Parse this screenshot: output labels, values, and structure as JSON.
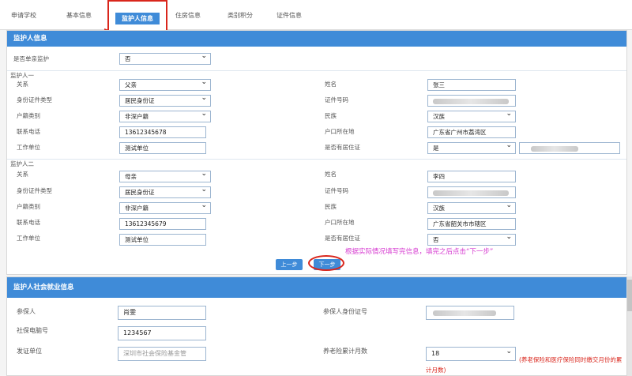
{
  "tabs": [
    {
      "label": "申请学校"
    },
    {
      "label": "基本信息"
    },
    {
      "label": "监护人信息"
    },
    {
      "label": "住房信息"
    },
    {
      "label": "类别积分"
    },
    {
      "label": "证件信息"
    }
  ],
  "panel1": {
    "title": "监护人信息",
    "single_parent_label": "是否单亲监护",
    "single_parent_value": "否",
    "guardian1": {
      "title": "监护人一",
      "relation_label": "关系",
      "relation_value": "父亲",
      "id_type_label": "身份证件类型",
      "id_type_value": "居民身份证",
      "hukou_label": "户籍类别",
      "hukou_value": "非深户籍",
      "phone_label": "联系电话",
      "phone_value": "13612345678",
      "work_label": "工作单位",
      "work_value": "测试单位",
      "name_label": "姓名",
      "name_value": "张三",
      "id_no_label": "证件号码",
      "ethnic_label": "民族",
      "ethnic_value": "汉族",
      "hukou_place_label": "户口所在地",
      "hukou_place_value": "广东省广州市荔湾区",
      "residence_label": "是否有居住证",
      "residence_value": "是"
    },
    "guardian2": {
      "title": "监护人二",
      "relation_label": "关系",
      "relation_value": "母亲",
      "id_type_label": "身份证件类型",
      "id_type_value": "居民身份证",
      "hukou_label": "户籍类别",
      "hukou_value": "非深户籍",
      "phone_label": "联系电话",
      "phone_value": "13612345679",
      "work_label": "工作单位",
      "work_value": "测试单位",
      "name_label": "姓名",
      "name_value": "李四",
      "id_no_label": "证件号码",
      "ethnic_label": "民族",
      "ethnic_value": "汉族",
      "hukou_place_label": "户口所在地",
      "hukou_place_value": "广东省韶关市市辖区",
      "residence_label": "是否有居住证",
      "residence_value": "否"
    },
    "hint": "根据实际情况填写完信息，填完之后点击“下一步”",
    "prev_label": "上一步",
    "next_label": "下一步"
  },
  "panel2": {
    "title": "监护人社会就业信息",
    "insured_label": "参保人",
    "insured_value": "肖雯",
    "insured_id_label": "参保人身份证号",
    "ss_no_label": "社保电脑号",
    "ss_no_value": "1234567",
    "issuer_label": "发证单位",
    "issuer_placeholder": "深圳市社会保险基金管",
    "months_label": "养老险累计月数",
    "months_value": "18",
    "months_note": "(养老保险和医疗保险同时缴交月份的累计月数)"
  },
  "colors": {
    "accent": "#3f8bd8",
    "highlight": "#d9261c",
    "hint": "#d63ad0"
  }
}
